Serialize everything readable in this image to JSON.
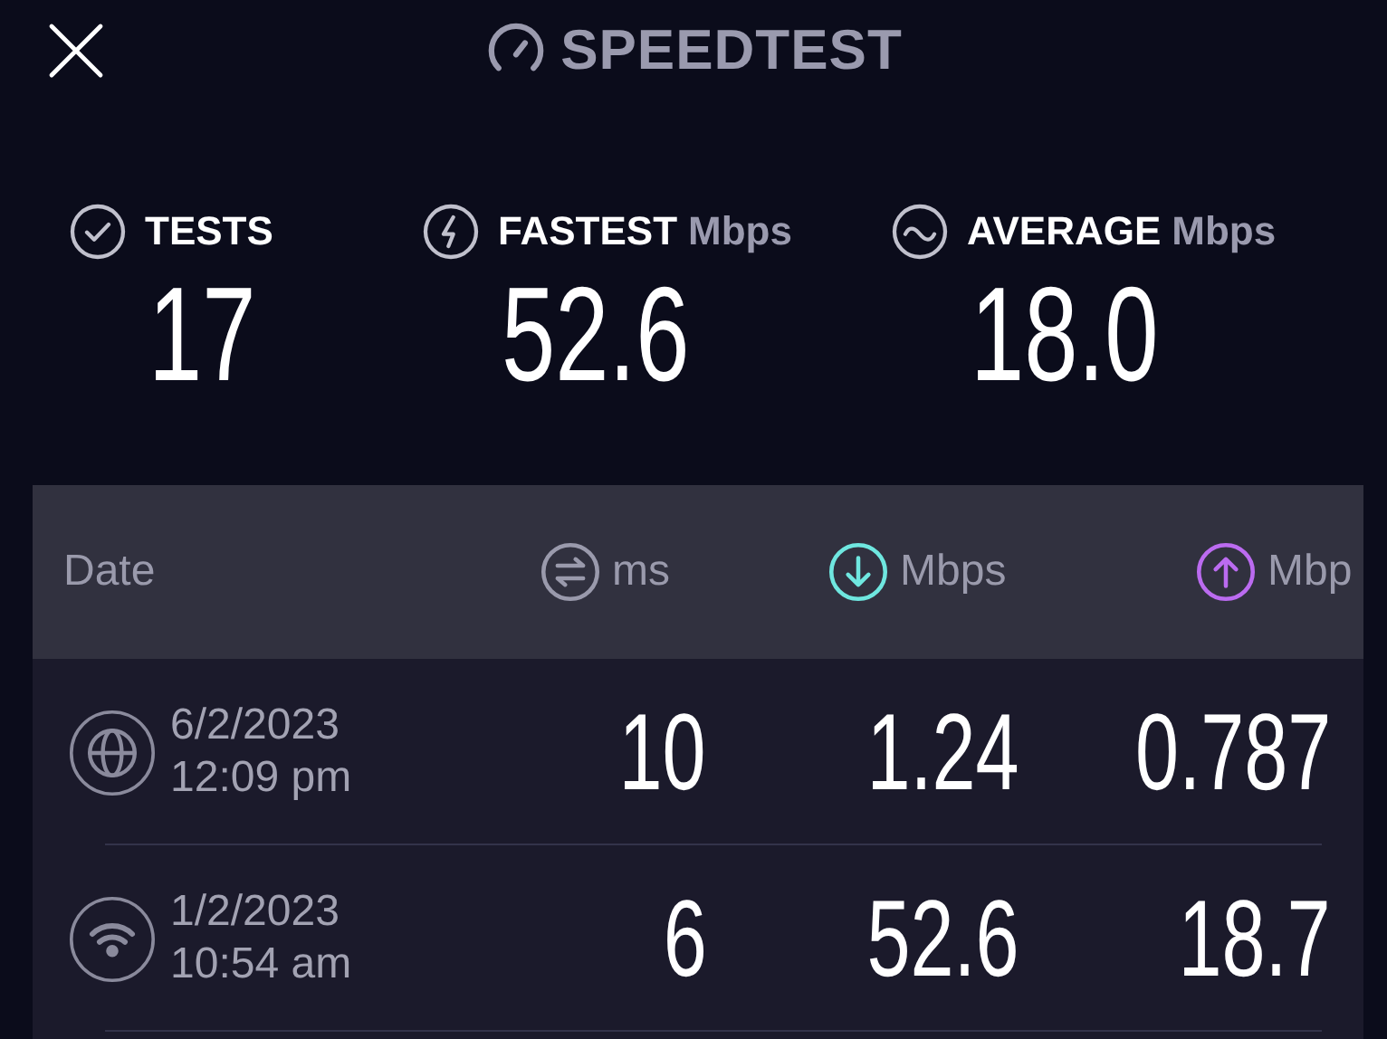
{
  "header": {
    "title": "SPEEDTEST"
  },
  "stats": [
    {
      "kind": "check",
      "label": "TESTS",
      "value": "17"
    },
    {
      "kind": "bolt",
      "label": "FASTEST",
      "unit": "Mbps",
      "value": "52.6"
    },
    {
      "kind": "wave",
      "label": "AVERAGE",
      "unit": "Mbps",
      "value": "18.0"
    }
  ],
  "table": {
    "columns": [
      {
        "kind": "text",
        "label": "Date"
      },
      {
        "kind": "ping",
        "label": "ms",
        "color": "#9a9aac"
      },
      {
        "kind": "download",
        "label": "Mbps",
        "color": "#6fe7e0"
      },
      {
        "kind": "upload",
        "label": "Mbp",
        "color": "#bb6bf0"
      }
    ],
    "rows": [
      {
        "kind": "globe",
        "date": "6/2/2023",
        "time": "12:09 pm",
        "ping": "10",
        "download": "1.24",
        "upload": "0.787"
      },
      {
        "kind": "wifi",
        "date": "1/2/2023",
        "time": "10:54 am",
        "ping": "6",
        "download": "52.6",
        "upload": "18.7"
      }
    ]
  }
}
